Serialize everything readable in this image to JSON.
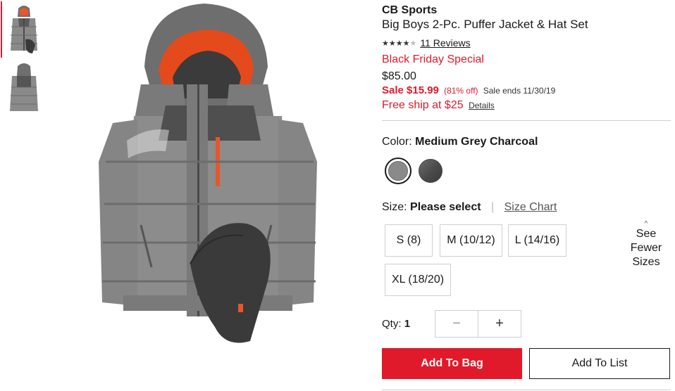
{
  "product": {
    "brand": "CB Sports",
    "title": "Big Boys 2-Pc. Puffer Jacket & Hat Set",
    "rating_stars": 4,
    "rating_max": 5,
    "reviews_label": "11 Reviews",
    "promo": "Black Friday Special",
    "original_price": "$85.00",
    "sale_label": "Sale $15.99",
    "sale_pct": "(81% off)",
    "sale_ends": "Sale ends 11/30/19",
    "free_ship": "Free ship at $25",
    "details_link": "Details"
  },
  "color": {
    "label": "Color:",
    "selected": "Medium Grey Charcoal",
    "swatches": [
      {
        "name": "Medium Grey Charcoal",
        "hex": "#8a8a8a",
        "selected": true
      },
      {
        "name": "Charcoal",
        "hex": "#4a4a4a",
        "selected": false
      }
    ]
  },
  "size": {
    "label": "Size:",
    "selected": "Please select",
    "chart_link": "Size Chart",
    "options": [
      "S (8)",
      "M (10/12)",
      "L (14/16)",
      "XL (18/20)"
    ],
    "toggle": {
      "line1": "See",
      "line2": "Fewer",
      "line3": "Sizes"
    }
  },
  "quantity": {
    "label": "Qty:",
    "value": "1",
    "minus": "−",
    "plus": "+"
  },
  "actions": {
    "add_to_bag": "Add To Bag",
    "add_to_list": "Add To List"
  },
  "colors": {
    "accent_red": "#e01a2b",
    "text": "#1a1a1a",
    "border": "#cfcfcf"
  }
}
